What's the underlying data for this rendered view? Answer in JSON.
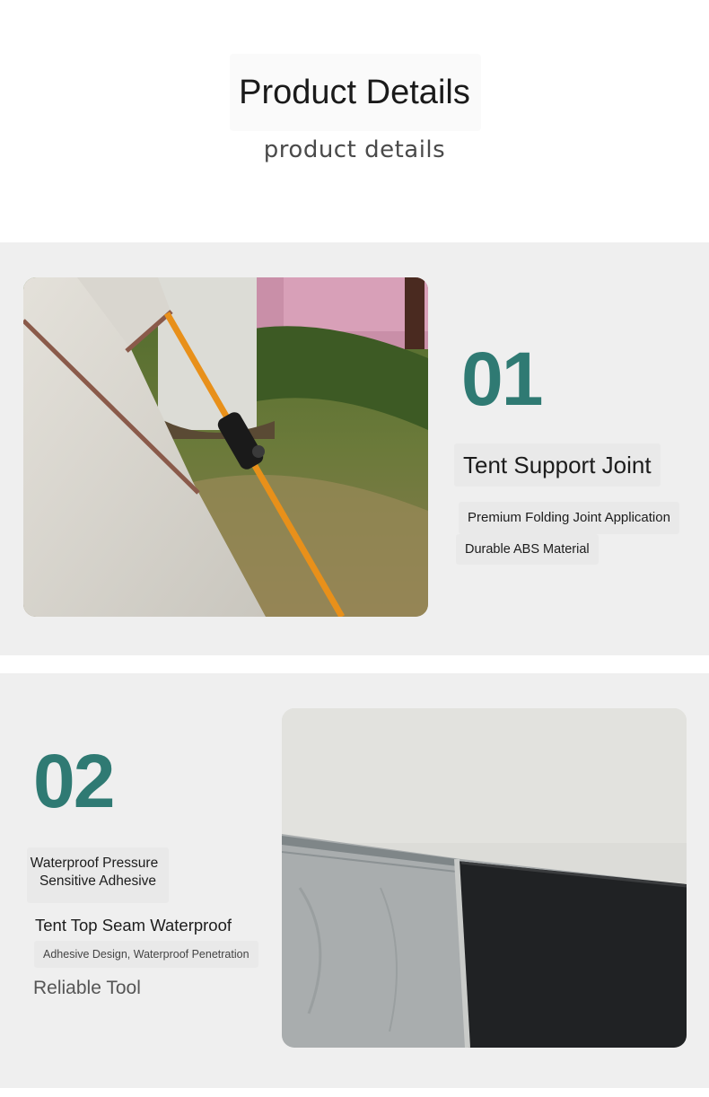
{
  "header": {
    "title": "Product Details",
    "subtitle": "product details"
  },
  "feature1": {
    "number": "01",
    "heading": "Tent Support Joint",
    "line1": "Premium Folding Joint Application",
    "line2": "Durable ABS Material",
    "image": "tent-pole-joint-photo"
  },
  "feature2": {
    "number": "02",
    "label_line1": "Waterproof Pressure",
    "label_line2": "Sensitive Adhesive",
    "heading": "Tent Top Seam Waterproof",
    "description": "Adhesive Design, Waterproof Penetration",
    "tagline": "Reliable Tool",
    "image": "tent-seam-closeup-photo"
  },
  "colors": {
    "accent": "#2f7a73",
    "section_bg": "#efefef"
  }
}
